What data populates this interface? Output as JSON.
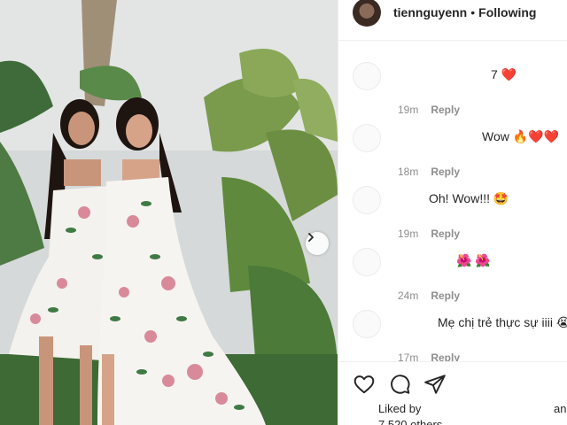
{
  "header": {
    "username": "tiennguyenn",
    "separator": "•",
    "follow_label": "Following"
  },
  "comments": [
    {
      "text": "7 ❤️",
      "time": "19m",
      "reply": "Reply"
    },
    {
      "text": "Wow 🔥❤️❤️",
      "time": "18m",
      "reply": "Reply"
    },
    {
      "text": "Oh! Wow!!! 🤩",
      "time": "19m",
      "reply": "Reply"
    },
    {
      "text": "🌺 🌺",
      "time": "24m",
      "reply": "Reply"
    },
    {
      "text": "Mẹ chị trẻ thực sự iiii 😭",
      "time": "17m",
      "reply": "Reply"
    }
  ],
  "likes": {
    "prefix": "Liked by",
    "suffix": "and",
    "others": "7,520 others"
  },
  "icons": [
    "heart-icon",
    "comment-icon",
    "share-icon",
    "chevron-right-icon"
  ],
  "colors": {
    "background": "#ffffff",
    "text": "#262626",
    "muted": "#8e8e8e",
    "divider": "#efefef"
  }
}
